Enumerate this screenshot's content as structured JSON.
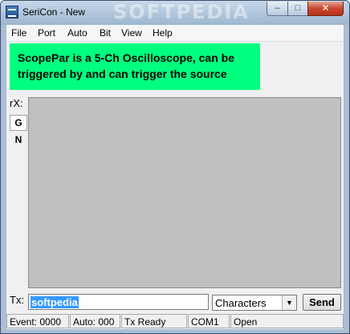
{
  "window": {
    "title": "SeriCon - New",
    "watermark": "SOFTPEDIA",
    "min_glyph": "–",
    "max_glyph": "□",
    "close_glyph": "✕"
  },
  "menu": {
    "items": [
      "File",
      "Port",
      "Auto",
      "Bit",
      "View",
      "Help"
    ]
  },
  "banner": {
    "line1": "ScopePar is a 5-Ch Oscilloscope, can be",
    "line2": "triggered by and can trigger the source"
  },
  "receive": {
    "label": "rX:",
    "mode_g": "G",
    "mode_n": "N"
  },
  "transmit": {
    "label": "Tx:",
    "value": "softpedia",
    "format_selected": "Characters",
    "send_label": "Send"
  },
  "status": {
    "event": "Event: 0000",
    "auto": "Auto: 000",
    "tx": "Tx Ready",
    "port": "COM1",
    "state": "Open"
  },
  "colors": {
    "banner_bg": "#00ff7f",
    "display_bg": "#c0c0c0",
    "selection": "#3399ff"
  }
}
